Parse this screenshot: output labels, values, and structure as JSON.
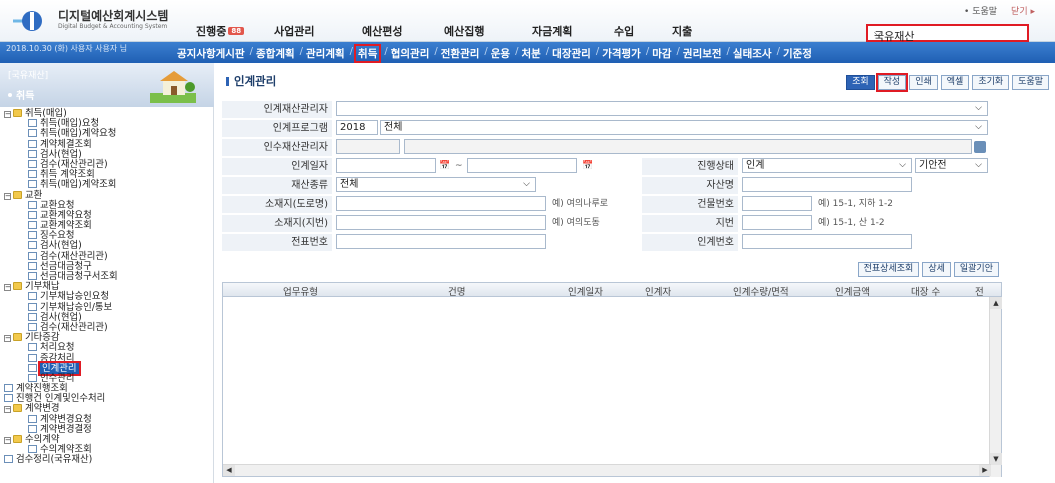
{
  "app": {
    "title": "디지털예산회계시스템",
    "subtitle": "Digital Budget & Accounting System"
  },
  "util_links": [
    "• 도움말",
    "닫기 ▸"
  ],
  "main_menu": [
    {
      "label": "진행중",
      "badge": "88"
    },
    {
      "label": "사업관리"
    },
    {
      "label": "예산편성"
    },
    {
      "label": "예산집행"
    },
    {
      "label": "자금계획"
    },
    {
      "label": "수입"
    },
    {
      "label": "지출"
    }
  ],
  "asset_select": {
    "value": "국유재산"
  },
  "subnav": {
    "date_user": "2018.10.30 (화) 사용자 사용자 님",
    "items": [
      "공지사항게시판",
      "종합계획",
      "관리계획",
      "취득",
      "협의관리",
      "전환관리",
      "운용",
      "처분",
      "대장관리",
      "가격평가",
      "마감",
      "권리보전",
      "실태조사",
      "기준정"
    ],
    "selected": "취득"
  },
  "sidebar": {
    "category": "[국유재산]",
    "section": "취득",
    "tree": [
      {
        "label": "취득(매입)",
        "type": "folder",
        "level": 1
      },
      {
        "label": "취득(매입)요청",
        "type": "doc",
        "level": 2
      },
      {
        "label": "취득(매입)계약요청",
        "type": "doc",
        "level": 2
      },
      {
        "label": "계약체결조회",
        "type": "doc",
        "level": 2
      },
      {
        "label": "검사(현업)",
        "type": "doc",
        "level": 2
      },
      {
        "label": "검수(재산관리관)",
        "type": "doc",
        "level": 2
      },
      {
        "label": "취득 계약조회",
        "type": "doc",
        "level": 2
      },
      {
        "label": "취득(매입)계약조회",
        "type": "doc",
        "level": 2
      },
      {
        "label": "교환",
        "type": "folder",
        "level": 1
      },
      {
        "label": "교환요청",
        "type": "doc",
        "level": 2
      },
      {
        "label": "교환계약요청",
        "type": "doc",
        "level": 2
      },
      {
        "label": "교환계약조회",
        "type": "doc",
        "level": 2
      },
      {
        "label": "징수요청",
        "type": "doc",
        "level": 2
      },
      {
        "label": "검사(현업)",
        "type": "doc",
        "level": 2
      },
      {
        "label": "검수(재산관리관)",
        "type": "doc",
        "level": 2
      },
      {
        "label": "선금대금청구",
        "type": "doc",
        "level": 2
      },
      {
        "label": "선금대금청구서조회",
        "type": "doc",
        "level": 2
      },
      {
        "label": "기부채납",
        "type": "folder",
        "level": 1
      },
      {
        "label": "기부채납승인요청",
        "type": "doc",
        "level": 2
      },
      {
        "label": "기부채납승인/통보",
        "type": "doc",
        "level": 2
      },
      {
        "label": "검사(현업)",
        "type": "doc",
        "level": 2
      },
      {
        "label": "검수(재산관리관)",
        "type": "doc",
        "level": 2
      },
      {
        "label": "기타증감",
        "type": "folder",
        "level": 1
      },
      {
        "label": "처리요청",
        "type": "doc",
        "level": 2
      },
      {
        "label": "증감처리",
        "type": "doc",
        "level": 2
      },
      {
        "label": "인계관리",
        "type": "doc",
        "level": 2,
        "selected": true
      },
      {
        "label": "인수관리",
        "type": "doc",
        "level": 2
      },
      {
        "label": "계약진행조회",
        "type": "doc",
        "level": 1
      },
      {
        "label": "진행건 인계및인수처리",
        "type": "doc",
        "level": 1
      },
      {
        "label": "계약변경",
        "type": "folder",
        "level": 1
      },
      {
        "label": "계약변경요청",
        "type": "doc",
        "level": 2
      },
      {
        "label": "계약변경결정",
        "type": "doc",
        "level": 2
      },
      {
        "label": "수의계약",
        "type": "folder",
        "level": 1
      },
      {
        "label": "수의계약조회",
        "type": "doc",
        "level": 2
      },
      {
        "label": "검수정리(국유재산)",
        "type": "doc",
        "level": 1
      }
    ]
  },
  "page": {
    "title": "인계관리",
    "toolbar": [
      "조회",
      "작성",
      "인쇄",
      "엑셀",
      "초기화",
      "도움말"
    ]
  },
  "form": {
    "labels": {
      "handover_manager": "인계재산관리자",
      "handover_program": "인계프로그램",
      "takeover_manager": "인수재산관리자",
      "handover_date": "인계일자",
      "progress_status": "진행상태",
      "asset_type": "재산종류",
      "asset_name": "자산명",
      "location_road": "소재지(도로명)",
      "building_no": "건물번호",
      "location_lot": "소재지(지번)",
      "lot_no": "지번",
      "slip_no": "전표번호",
      "handover_no": "인계번호"
    },
    "values": {
      "program_year": "2018",
      "program": "전체",
      "status1": "인계",
      "status2": "기안전",
      "asset_type": "전체"
    },
    "hints": {
      "road": "예) 여의나루로",
      "building": "예) 15-1, 지하 1-2",
      "lot_area": "예) 여의도동",
      "lot": "예) 15-1, 산 1-2"
    },
    "date_sep": "~"
  },
  "grid_buttons": [
    "전표상세조회",
    "상세",
    "일괄기안"
  ],
  "grid": {
    "columns": [
      "업무유형",
      "건명",
      "인계일자",
      "인계자",
      "인계수량/면적",
      "인계금액",
      "대장 수",
      "전"
    ]
  }
}
